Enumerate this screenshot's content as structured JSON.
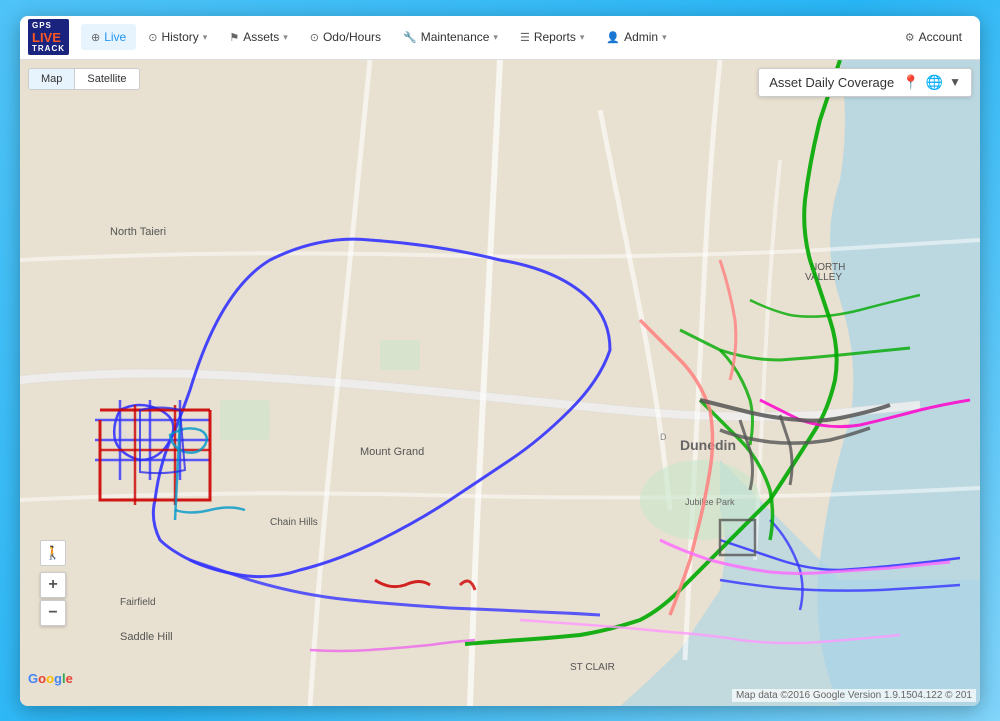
{
  "app": {
    "title": "GPS Live Track"
  },
  "navbar": {
    "logo_line1": "GPS",
    "logo_live": "LIVE",
    "logo_line2": "Track",
    "items": [
      {
        "id": "live",
        "label": "Live",
        "icon": "⊕",
        "has_arrow": false
      },
      {
        "id": "history",
        "label": "History",
        "icon": "⊙",
        "has_arrow": true
      },
      {
        "id": "assets",
        "label": "Assets",
        "icon": "⚑",
        "has_arrow": true
      },
      {
        "id": "odo_hours",
        "label": "Odo/Hours",
        "icon": "⊙",
        "has_arrow": false
      },
      {
        "id": "maintenance",
        "label": "Maintenance",
        "icon": "🔧",
        "has_arrow": true
      },
      {
        "id": "reports",
        "label": "Reports",
        "icon": "☰",
        "has_arrow": true
      },
      {
        "id": "admin",
        "label": "Admin",
        "icon": "👤",
        "has_arrow": true
      }
    ],
    "account_label": "Account",
    "account_icon": "⚙"
  },
  "map_controls": {
    "map_btn": "Map",
    "satellite_btn": "Satellite",
    "active": "map"
  },
  "coverage_panel": {
    "title": "Asset Daily Coverage",
    "pin_icon": "📍",
    "globe_icon": "🌐",
    "arrow_icon": "▼"
  },
  "zoom": {
    "person": "🚶",
    "plus": "+",
    "minus": "−"
  },
  "map_attribution": {
    "text": "Map data ©2016 Google  Version 1.9.1504.122 © 201"
  },
  "google_logo": "Google"
}
